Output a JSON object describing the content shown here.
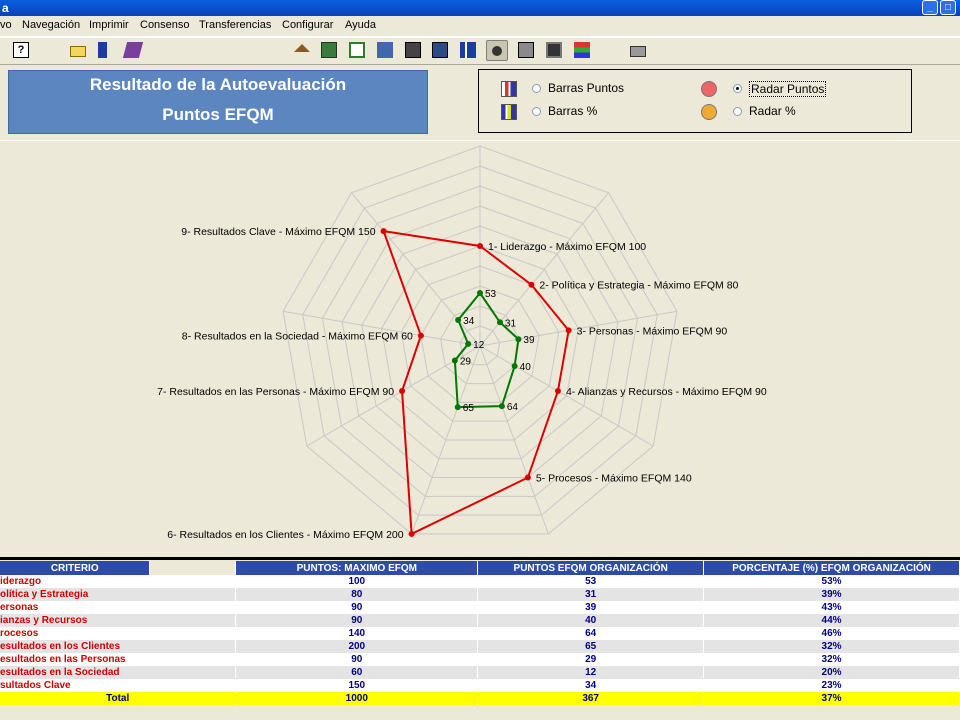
{
  "window": {
    "title": "a"
  },
  "menu": [
    "vo",
    "Navegación",
    "Imprimir",
    "Consenso",
    "Transferencias",
    "Configurar",
    "Ayuda"
  ],
  "header": {
    "line1": "Resultado de la Autoevaluación",
    "line2": "Puntos EFQM"
  },
  "options": [
    {
      "label": "Barras Puntos",
      "selected": false,
      "icon": "bar-chart-points-icon"
    },
    {
      "label": "Radar Puntos",
      "selected": true,
      "icon": "radar-points-icon"
    },
    {
      "label": "Barras %",
      "selected": false,
      "icon": "bar-chart-percent-icon"
    },
    {
      "label": "Radar %",
      "selected": false,
      "icon": "radar-percent-icon"
    }
  ],
  "chart_data": {
    "type": "radar",
    "axes": [
      "1- Liderazgo - Máximo EFQM 100",
      "2- Política y Estrategia - Máximo EFQM 80",
      "3- Personas - Máximo EFQM 90",
      "4- Alianzas y Recursos - Máximo EFQM 90",
      "5- Procesos - Máximo EFQM 140",
      "6- Resultados en los Clientes - Máximo EFQM 200",
      "7- Resultados en las Personas - Máximo EFQM 90",
      "8- Resultados en la Sociedad - Máximo EFQM 60",
      "9- Resultados Clave - Máximo EFQM 150"
    ],
    "rmax": 200,
    "grid_rings": 10,
    "series": [
      {
        "values": [
          100,
          80,
          90,
          90,
          140,
          200,
          90,
          60,
          150
        ],
        "color": "#DD0000"
      },
      {
        "values": [
          53,
          31,
          39,
          40,
          64,
          65,
          29,
          12,
          34
        ],
        "color": "#007700",
        "labels": [
          "53",
          "31",
          "39",
          "40",
          "64",
          "65",
          "29",
          "12",
          "34"
        ]
      }
    ]
  },
  "table": {
    "headers": [
      "CRITERIO",
      "PUNTOS: MAXIMO EFQM",
      "PUNTOS EFQM ORGANIZACIÓN",
      "PORCENTAJE (%) EFQM ORGANIZACIÓN"
    ],
    "rows": [
      [
        "iderazgo",
        "100",
        "53",
        "53%"
      ],
      [
        "olítica y Estrategia",
        "80",
        "31",
        "39%"
      ],
      [
        "ersonas",
        "90",
        "39",
        "43%"
      ],
      [
        "ianzas y Recursos",
        "90",
        "40",
        "44%"
      ],
      [
        "rocesos",
        "140",
        "64",
        "46%"
      ],
      [
        "esultados en los Clientes",
        "200",
        "65",
        "32%"
      ],
      [
        "esultados en las Personas",
        "90",
        "29",
        "32%"
      ],
      [
        "esultados en la Sociedad",
        "60",
        "12",
        "20%"
      ],
      [
        "sultados Clave",
        "150",
        "34",
        "23%"
      ]
    ],
    "total": [
      "Total",
      "1000",
      "367",
      "37%"
    ]
  }
}
